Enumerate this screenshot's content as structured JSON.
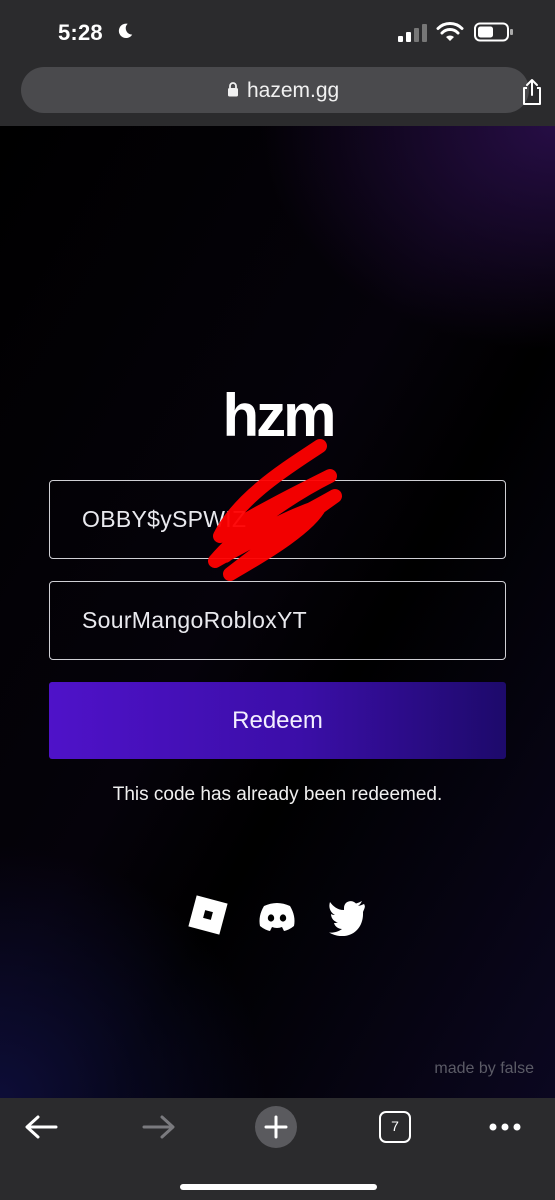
{
  "status_bar": {
    "time": "5:28",
    "icons": [
      "moon-icon",
      "signal-icon",
      "wifi-icon",
      "battery-icon"
    ]
  },
  "browser": {
    "url": "hazem.gg",
    "lock_icon": "lock-icon",
    "share_icon": "share-icon"
  },
  "page": {
    "logo_text": "hzm",
    "code_input_value": "OBBY$ySPWIZ",
    "username_input_value": "SourMangoRobloxYT",
    "redeem_label": "Redeem",
    "message": "This code has already been redeemed.",
    "social_icons": [
      "roblox-icon",
      "discord-icon",
      "twitter-icon"
    ],
    "credit": "made by false"
  },
  "toolbar": {
    "tab_count": "7",
    "icons": [
      "back-icon",
      "forward-icon",
      "plus-icon",
      "tabs-icon",
      "more-icon"
    ]
  },
  "colors": {
    "button_start": "#4f12c9",
    "button_end": "#1d0a6b",
    "background": "#000000",
    "scribble": "#ff0000"
  }
}
